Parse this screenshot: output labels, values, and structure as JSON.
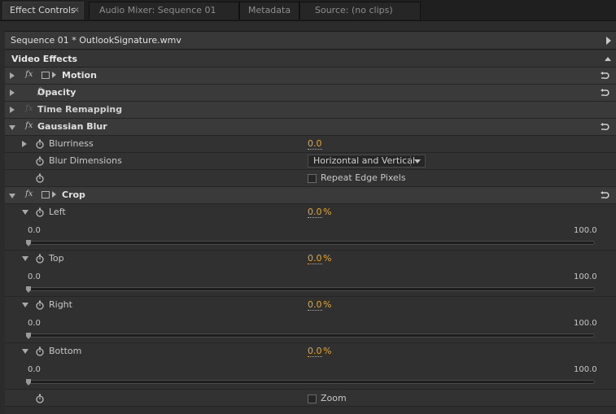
{
  "tabs": [
    {
      "label": "Effect Controls",
      "active": true,
      "closable": true
    },
    {
      "label": "Audio Mixer: Sequence 01"
    },
    {
      "label": "Metadata"
    },
    {
      "label": "Source: (no clips)"
    }
  ],
  "sequence_label": "Sequence 01 * OutlookSignature.wmv",
  "video_effects_label": "Video Effects",
  "effects": {
    "motion": "Motion",
    "opacity": "Opacity",
    "time_remapping": "Time Remapping",
    "gaussian_blur": "Gaussian Blur",
    "crop": "Crop"
  },
  "fx_glyph": "fx",
  "gaussian_blur": {
    "blurriness_label": "Blurriness",
    "blurriness_value": "0.0",
    "dimensions_label": "Blur Dimensions",
    "dimensions_value": "Horizontal and Vertical",
    "repeat_edge_label": "Repeat Edge Pixels",
    "repeat_edge_checked": false
  },
  "crop": {
    "left_label": "Left",
    "top_label": "Top",
    "right_label": "Right",
    "bottom_label": "Bottom",
    "value": "0.0",
    "unit": "%",
    "slider_min": "0.0",
    "slider_max": "100.0",
    "zoom_label": "Zoom",
    "zoom_checked": false
  },
  "colors": {
    "accent_value": "#e9a727",
    "panel_bg": "#2e2e2e"
  },
  "icons": [
    "reset-icon",
    "stopwatch-icon",
    "fx-icon",
    "transform-box-icon",
    "expand-triangle-icon",
    "collapse-triangle-icon",
    "dropdown-arrow-icon"
  ]
}
